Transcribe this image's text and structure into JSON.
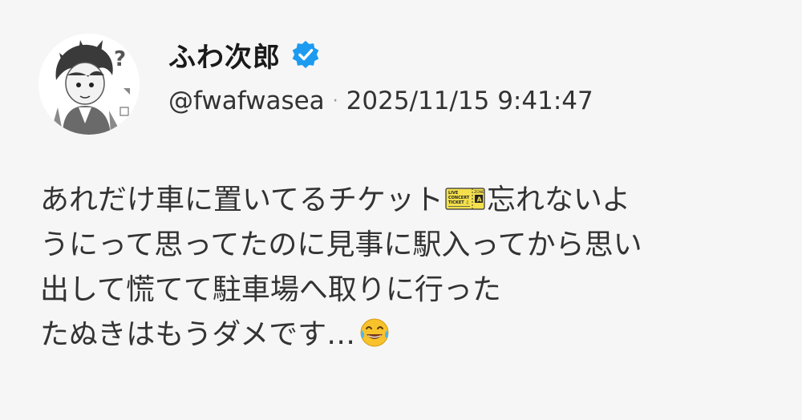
{
  "user": {
    "display_name": "ふわ次郎",
    "handle": "@fwafwasea",
    "verified_icon": "verified-badge-icon",
    "avatar_icon": "avatar-manga-character"
  },
  "post": {
    "timestamp": "2025/11/15 9:41:47",
    "separator": "·",
    "lines": [
      {
        "before": "あれだけ車に置いてるチケット",
        "after": "忘れないよ"
      },
      {
        "text": "うにって思ってたのに見事に駅入ってから思い"
      },
      {
        "text": "出して慌てて駐車場へ取りに行った"
      },
      {
        "text": "たぬきはもうダメです…"
      }
    ],
    "emoji": {
      "ticket": {
        "name": "ticket-emoji",
        "line1": "LIVE",
        "line2": "CONCERT",
        "line3": "TICKET ♫",
        "zone_label": "ZONE",
        "zone": "A"
      },
      "laugh": "tears-of-joy-emoji"
    }
  },
  "colors": {
    "background": "#f7f6f7",
    "verified_blue": "#1d9bf0",
    "text": "#333333"
  }
}
